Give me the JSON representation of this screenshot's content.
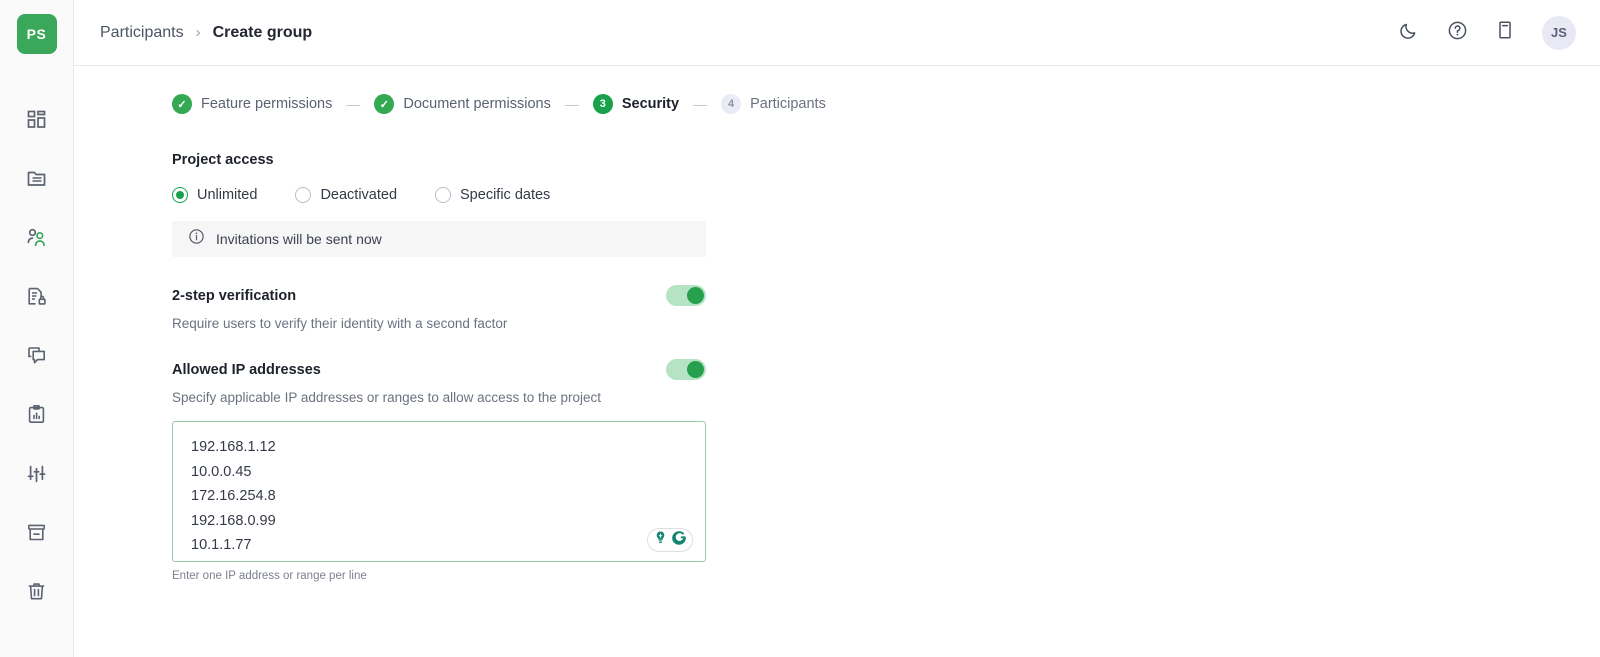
{
  "brand": {
    "logo_text": "PS",
    "logo_color": "#3aa75a"
  },
  "sidebar": {
    "items": [
      {
        "name": "dashboard",
        "icon": "grid-dashboard-icon",
        "active": false
      },
      {
        "name": "documents",
        "icon": "folder-document-icon",
        "active": false
      },
      {
        "name": "participants",
        "icon": "people-icon",
        "active": true
      },
      {
        "name": "secure-documents",
        "icon": "document-lock-icon",
        "active": false
      },
      {
        "name": "comments",
        "icon": "comment-icon",
        "active": false
      },
      {
        "name": "reports",
        "icon": "clipboard-chart-icon",
        "active": false
      },
      {
        "name": "settings",
        "icon": "sliders-icon",
        "active": false
      },
      {
        "name": "archive",
        "icon": "archive-box-icon",
        "active": false
      },
      {
        "name": "trash",
        "icon": "trash-icon",
        "active": false
      }
    ],
    "active_color": "#3aa75a",
    "icon_color": "#5b6270"
  },
  "topbar": {
    "breadcrumb": {
      "parent": "Participants",
      "separator": "›",
      "current": "Create group"
    },
    "actions": [
      {
        "name": "dark-mode-toggle",
        "icon": "moon-icon"
      },
      {
        "name": "help-button",
        "icon": "question-circle-icon"
      },
      {
        "name": "guide-panel-button",
        "icon": "panel-icon"
      }
    ],
    "avatar": {
      "initials": "JS"
    }
  },
  "stepper": {
    "separator": "—",
    "steps": [
      {
        "label": "Feature permissions",
        "state": "done",
        "badge": "✓"
      },
      {
        "label": "Document permissions",
        "state": "done",
        "badge": "✓"
      },
      {
        "label": "Security",
        "state": "active",
        "badge": "3"
      },
      {
        "label": "Participants",
        "state": "pending",
        "badge": "4"
      }
    ]
  },
  "project_access": {
    "title": "Project access",
    "options": [
      {
        "label": "Unlimited",
        "selected": true
      },
      {
        "label": "Deactivated",
        "selected": false
      },
      {
        "label": "Specific dates",
        "selected": false
      }
    ],
    "banner": {
      "icon": "info-circle-icon",
      "text": "Invitations will be sent now"
    }
  },
  "two_step": {
    "title": "2-step verification",
    "description": "Require users to verify their identity with a second factor",
    "enabled": true
  },
  "allowed_ips": {
    "title": "Allowed IP addresses",
    "description": "Specify applicable IP addresses or ranges to allow access to the project",
    "enabled": true,
    "value_lines": [
      "192.168.1.12",
      "10.0.0.45",
      "172.16.254.8",
      "192.168.0.99",
      "10.1.1.77"
    ],
    "hint": "Enter one IP address or range per line",
    "assistant_widget": {
      "name": "writing-assistant-widget",
      "icons": [
        "lightbulb-icon",
        "grammarly-g-icon"
      ],
      "color": "#11836f"
    }
  },
  "colors": {
    "accent_green": "#18a04a",
    "toggle_track": "#b6e3c3",
    "border": "#e8e8ea",
    "text": "#2f3542"
  }
}
